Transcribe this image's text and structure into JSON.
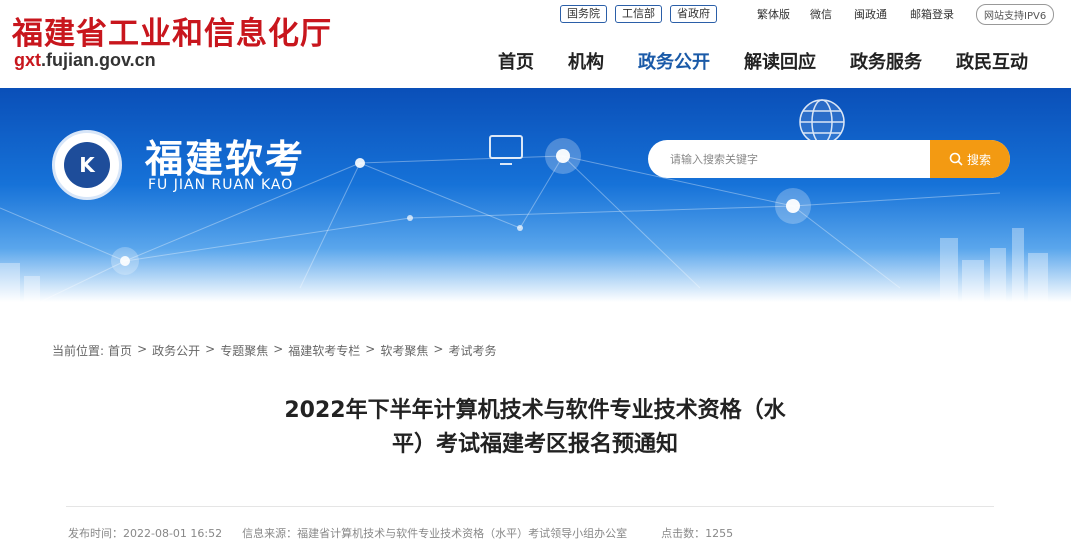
{
  "header": {
    "site_title": "福建省工业和信息化厅",
    "domain_prefix": "gxt",
    "domain_rest": ".fujian.gov.cn",
    "top_links_boxed": [
      "国务院",
      "工信部",
      "省政府"
    ],
    "top_links_plain": [
      "繁体版",
      "微信",
      "闽政通",
      "邮箱登录"
    ],
    "ipv6_label": "网站支持IPV6",
    "nav": [
      "首页",
      "机构",
      "政务公开",
      "解读回应",
      "政务服务",
      "政民互动"
    ],
    "active_nav": "政务公开"
  },
  "banner": {
    "title": "福建软考",
    "subtitle": "FU JIAN RUAN KAO",
    "logo_mark": "K",
    "search_placeholder": "请输入搜索关键字",
    "search_button": "搜索"
  },
  "breadcrumb": {
    "label": "当前位置:",
    "items": [
      "首页",
      "政务公开",
      "专题聚焦",
      "福建软考专栏",
      "软考聚焦",
      "考试考务"
    ]
  },
  "article": {
    "title_line1": "2022年下半年计算机技术与软件专业技术资格（水",
    "title_line2": "平）考试福建考区报名预通知",
    "publish_time": "发布时间：2022-08-01 16:52",
    "source": "信息来源：福建省计算机技术与软件专业技术资格（水平）考试领导小组办公室",
    "hits": "点击数：1255"
  },
  "colors": {
    "brand_red": "#c8161d",
    "nav_active": "#1a5aa8",
    "search_button": "#f39a12",
    "banner_blue": "#1672d8"
  }
}
